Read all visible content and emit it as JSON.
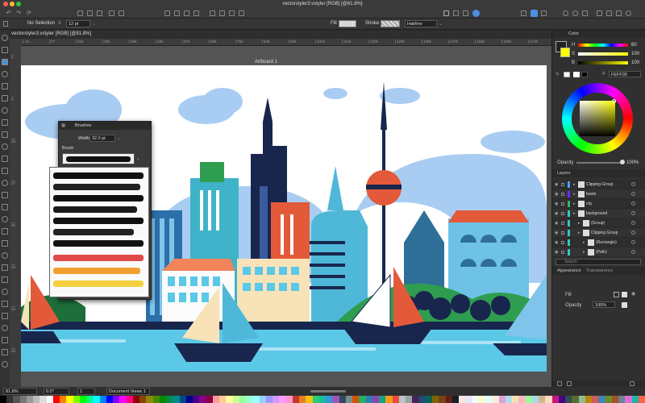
{
  "window": {
    "title": "vectorstyler3.vstyler [RGB] [@81.8%]"
  },
  "toolbar": {
    "selection_label": "No Selection",
    "stroke_width": "12 pt",
    "fill_label": "Fill",
    "stroke_label": "Stroke",
    "stroke_style": "Hairline"
  },
  "document": {
    "tab_label": "vectorstyler3.vstyler [RGB] [@81.8%]",
    "artboard_label": "Artboard 1",
    "ruler_ticks": [
      "-21",
      "27",
      "216",
      "306",
      "396",
      "486",
      "576",
      "666",
      "756",
      "846",
      "936",
      "1026",
      "1116",
      "1206",
      "1296",
      "1386",
      "1476",
      "1566",
      "1656",
      "1746"
    ],
    "ruler_v_ticks": [
      "0",
      "9",
      "18",
      "27",
      "36",
      "45",
      "54",
      "63"
    ]
  },
  "brushes_panel": {
    "title": "Brushes",
    "width_label": "Width",
    "width_value": "32.0 pt",
    "brush_label": "Brush"
  },
  "color_panel": {
    "tabs": [
      "Color"
    ],
    "h_label": "H",
    "h_value": "60",
    "s_label": "S",
    "s_value": "100",
    "b_label": "B",
    "b_value": "100",
    "hex_value": "FEFF00",
    "opacity_label": "Opacity",
    "opacity_value": "100%"
  },
  "layers_panel": {
    "title": "Layers",
    "search_placeholder": "Search",
    "items": [
      {
        "label": "Clipping Group",
        "color": "#4aa0ff"
      },
      {
        "label": "boats",
        "color": "#6a2cff"
      },
      {
        "label": "city",
        "color": "#36b55a"
      },
      {
        "label": "background",
        "color": "#36c6c6"
      },
      {
        "label": "(Group)",
        "color": "#36c6c6"
      },
      {
        "label": "Clipping Group",
        "color": "#36c6c6"
      },
      {
        "label": "(Rectangle)",
        "color": "#36c6c6"
      },
      {
        "label": "(Path)",
        "color": "#36c6c6"
      }
    ]
  },
  "appearance_panel": {
    "tabs": [
      "Appearance",
      "Transparency"
    ],
    "fill_label": "Fill",
    "opacity_label": "Opacity",
    "opacity_value": "100%"
  },
  "statusbar": {
    "zoom": "81.8%",
    "angle": "0.0°",
    "page": "1",
    "view": "Document Views 1"
  },
  "colors": {
    "accent": "#FEFF00",
    "sky": "#ffffff",
    "water": "#5cc8e8"
  },
  "swatches": [
    "#000000",
    "#333333",
    "#555555",
    "#777777",
    "#999999",
    "#bbbbbb",
    "#dddddd",
    "#ffffff",
    "#ff0000",
    "#ff7f00",
    "#ffff00",
    "#7fff00",
    "#00ff00",
    "#00ff7f",
    "#00ffff",
    "#007fff",
    "#0000ff",
    "#7f00ff",
    "#ff00ff",
    "#ff007f",
    "#8b0000",
    "#8b4500",
    "#8b8b00",
    "#458b00",
    "#008b00",
    "#008b45",
    "#008b8b",
    "#00458b",
    "#00008b",
    "#45008b",
    "#8b008b",
    "#8b0045",
    "#ff9999",
    "#ffcc99",
    "#ffff99",
    "#ccff99",
    "#99ff99",
    "#99ffcc",
    "#99ffff",
    "#99ccff",
    "#9999ff",
    "#cc99ff",
    "#ff99ff",
    "#ff99cc",
    "#c0392b",
    "#e67e22",
    "#f1c40f",
    "#2ecc71",
    "#1abc9c",
    "#3498db",
    "#9b59b6",
    "#34495e",
    "#7f8c8d",
    "#d35400",
    "#27ae60",
    "#2980b9",
    "#8e44ad",
    "#16a085",
    "#f39c12",
    "#e74c3c",
    "#bdc3c7",
    "#95a5a6",
    "#4a235a",
    "#1b4f72",
    "#0e6251",
    "#7d6608",
    "#784212",
    "#641e16",
    "#17202a",
    "#ffe4e1",
    "#e6e6fa",
    "#f0fff0",
    "#fffacd",
    "#e0ffff",
    "#faebd7",
    "#dda0dd",
    "#b0e0e6",
    "#f5deb3",
    "#ffb6c1",
    "#98fb98",
    "#add8e6",
    "#d2b48c",
    "#ffdab9",
    "#c71585",
    "#4b0082",
    "#2f4f4f",
    "#556b2f",
    "#8fbc8f",
    "#b8860b",
    "#cd5c5c",
    "#4682b4",
    "#6b8e23",
    "#a0522d",
    "#708090",
    "#da70d6",
    "#20b2aa",
    "#ff6347"
  ]
}
